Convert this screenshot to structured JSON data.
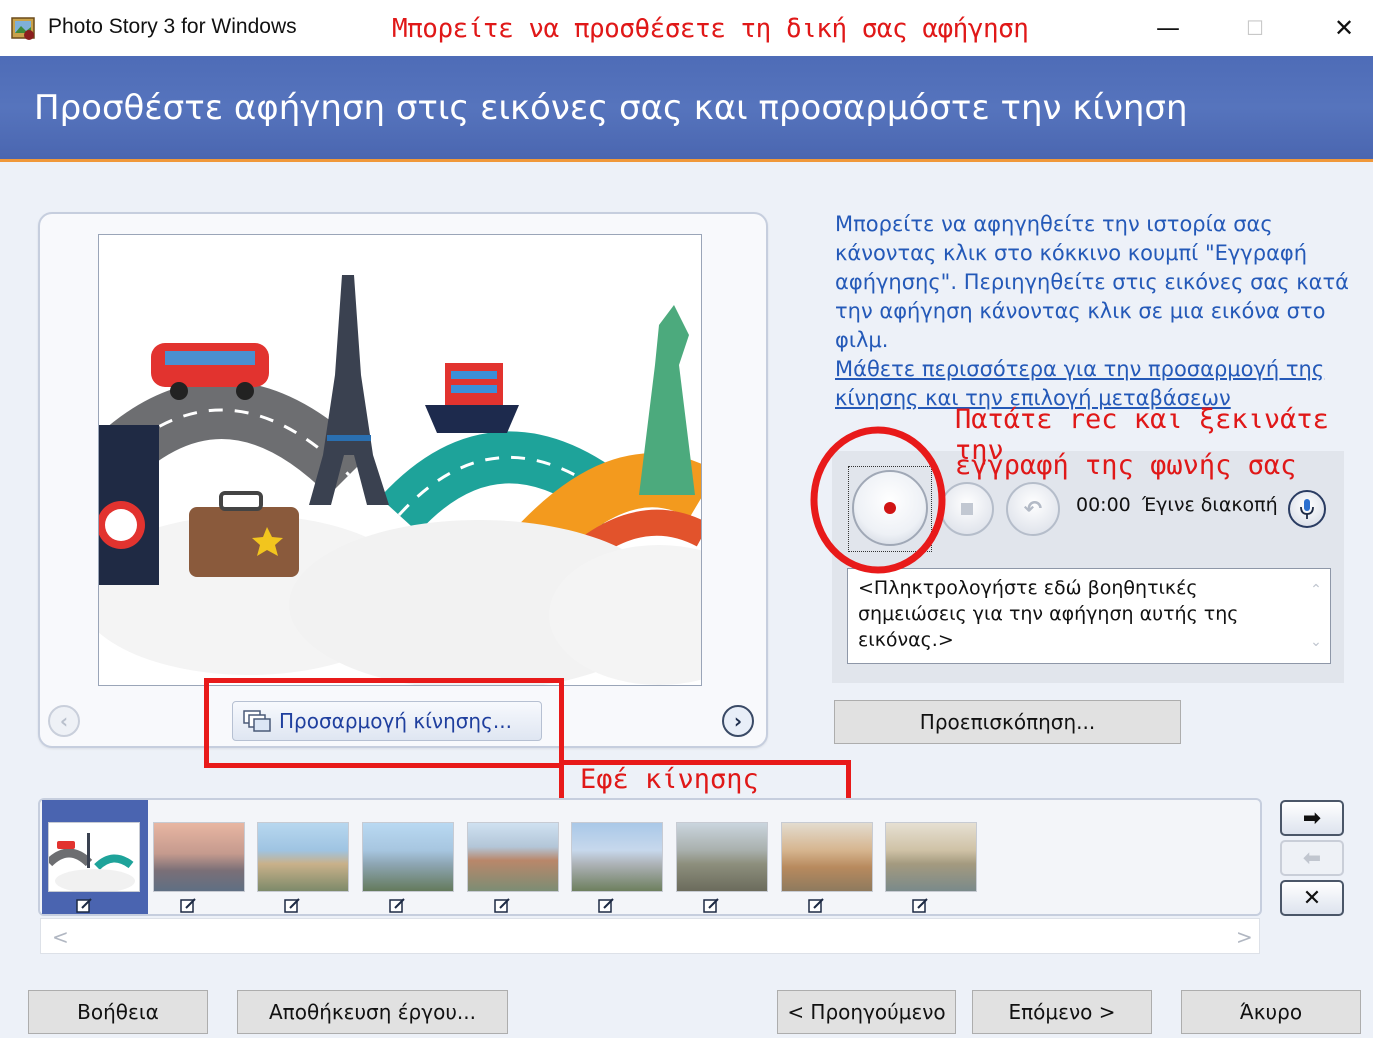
{
  "window": {
    "title": "Photo Story 3 for Windows",
    "annotation": "Μπορείτε να προσθέσετε τη δική σας αφήγηση",
    "minimize": "—",
    "maximize": "☐",
    "close": "✕"
  },
  "header": {
    "title": "Προσθέστε αφήγηση στις εικόνες σας και προσαρμόστε την κίνηση"
  },
  "preview": {
    "motion_button_label": "Προσαρμογή κίνησης...",
    "prev_icon": "chevron-left-icon",
    "next_icon": "chevron-right-icon"
  },
  "annotations": {
    "record_hint_line1": "Πατάτε rec και ξεκινάτε την",
    "record_hint_line2": "εγγραφή της φωνής σας",
    "motion_effect": "Εφέ κίνησης",
    "color": "#e01818"
  },
  "instructions": {
    "text": "Μπορείτε να αφηγηθείτε την ιστορία σας κάνοντας κλικ στο κόκκινο κουμπί \"Εγγραφή αφήγησης\". Περιηγηθείτε στις εικόνες σας κατά την αφήγηση κάνοντας κλικ σε μια εικόνα στο φιλμ.",
    "link": "Μάθετε περισσότερα για την προσαρμογή της κίνησης και την επιλογή μεταβάσεων"
  },
  "recorder": {
    "time": "00:00",
    "status": "Έγινε διακοπή",
    "notes_placeholder": "<Πληκτρολογήστε εδώ βοηθητικές σημειώσεις για την αφήγηση αυτής της εικόνας.>",
    "preview_button": "Προεπισκόπηση...",
    "scroll_up": "⌃",
    "scroll_down": "⌄"
  },
  "filmstrip": {
    "thumbnails": [
      {
        "name": "travel-illustration",
        "selected": true
      },
      {
        "name": "budapest-river",
        "selected": false
      },
      {
        "name": "arc-de-triomphe",
        "selected": false
      },
      {
        "name": "chain-bridge",
        "selected": false
      },
      {
        "name": "city-rooftops",
        "selected": false
      },
      {
        "name": "eiffel-tower",
        "selected": false
      },
      {
        "name": "old-town",
        "selected": false
      },
      {
        "name": "colosseum",
        "selected": false
      },
      {
        "name": "waterfront-buildings",
        "selected": false
      }
    ],
    "scroll_left": "<",
    "scroll_right": ">",
    "move_right": "➡",
    "move_left": "⬅",
    "remove": "✕"
  },
  "footer": {
    "help": "Βοήθεια",
    "save_project": "Αποθήκευση έργου...",
    "back": "< Προηγούμενο",
    "next": "Επόμενο >",
    "cancel": "Άκυρο"
  },
  "colors": {
    "header_blue": "#4e6cb7",
    "header_accent": "#f0983a",
    "link_blue": "#2459b8",
    "selection_blue": "#4a64b0"
  }
}
